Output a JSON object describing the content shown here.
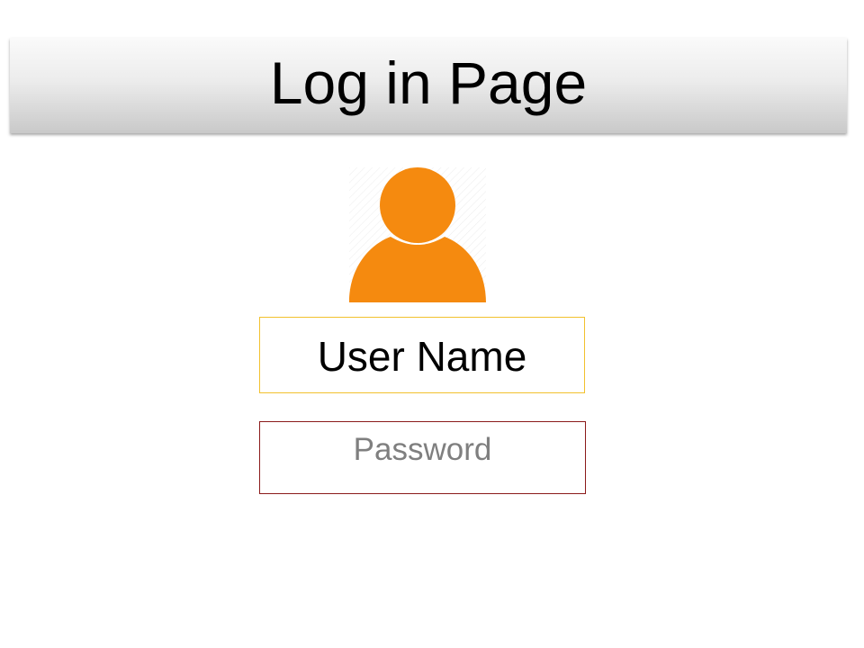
{
  "header": {
    "title": "Log in Page"
  },
  "avatar": {
    "icon": "user-icon",
    "color": "#f58a0f"
  },
  "form": {
    "username_value": "User Name",
    "password_placeholder": "Password"
  },
  "colors": {
    "username_border": "#f2c12e",
    "password_border": "#8b1a1a"
  }
}
